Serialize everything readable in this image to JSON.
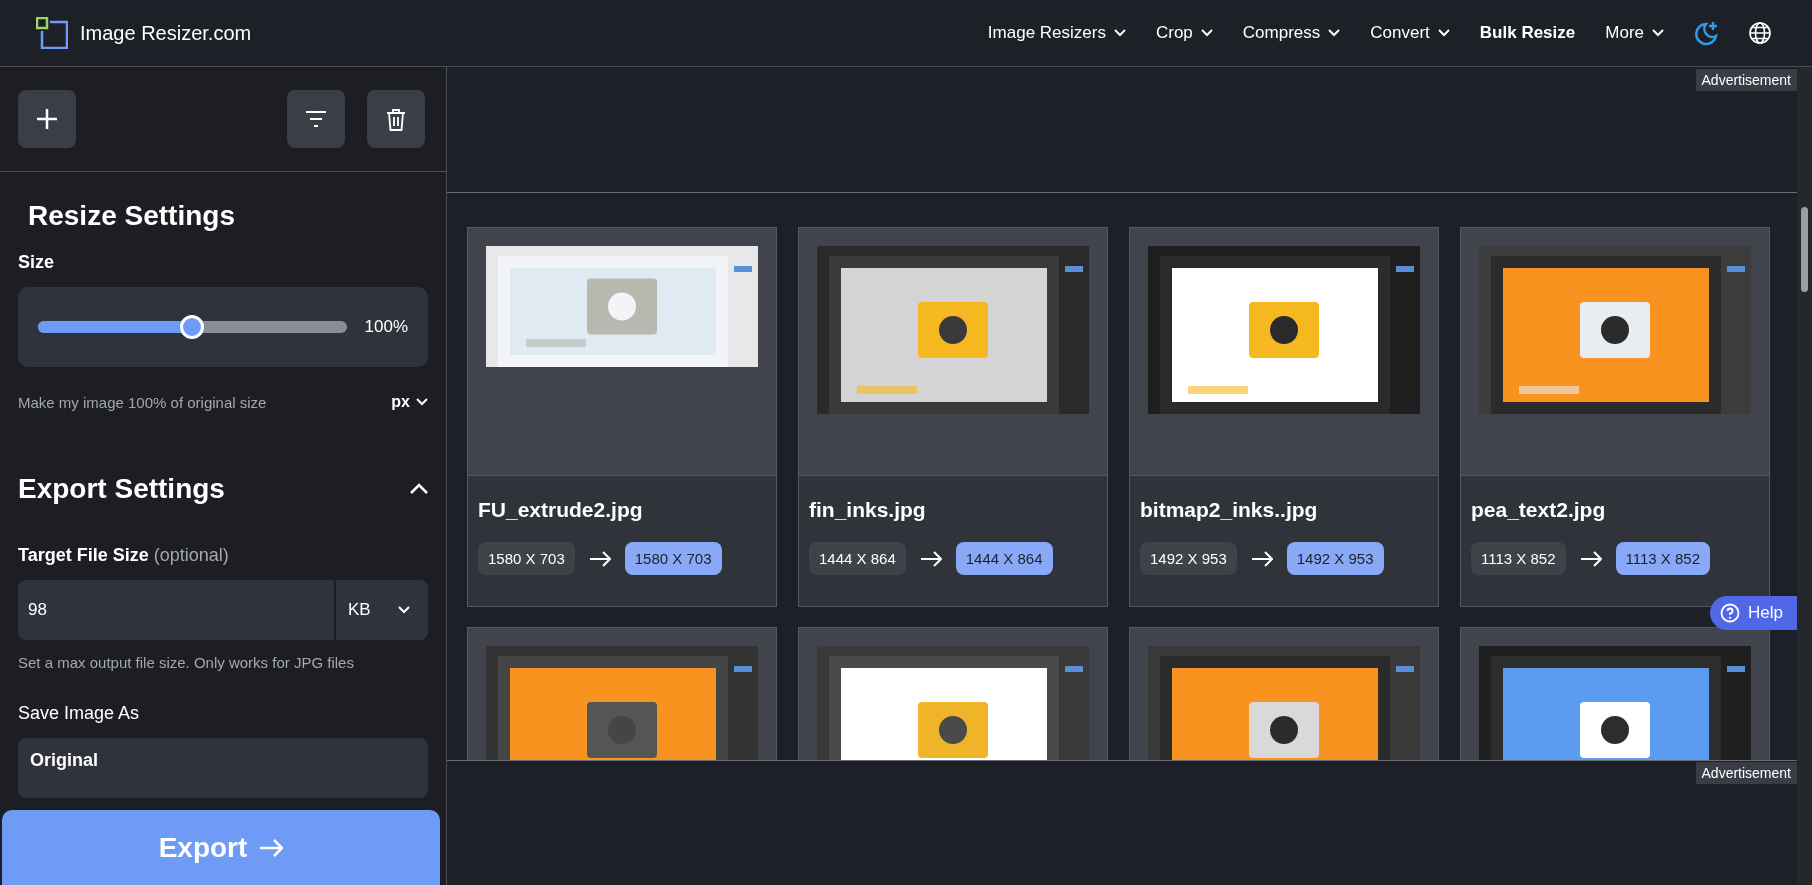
{
  "header": {
    "logo_text": "Image Resizer.com",
    "nav": [
      {
        "label": "Image Resizers",
        "kind": "menu"
      },
      {
        "label": "Crop",
        "kind": "menu"
      },
      {
        "label": "Compress",
        "kind": "menu"
      },
      {
        "label": "Convert",
        "kind": "menu"
      },
      {
        "label": "Bulk Resize",
        "kind": "link"
      },
      {
        "label": "More",
        "kind": "menu"
      }
    ]
  },
  "sidebar": {
    "resize_settings": {
      "title": "Resize Settings",
      "size_label": "Size",
      "slider": {
        "level": 0.5,
        "reading": "100%"
      },
      "hint": "Make my image 100% of original size",
      "unit": "px"
    },
    "export_settings": {
      "title": "Export Settings",
      "expanded": true,
      "target_label": "Target File Size",
      "target_optional": "(optional)",
      "target_value": "98",
      "target_unit": "KB",
      "target_hint": "Set a max output file size. Only works for JPG files",
      "save_as_label": "Save Image As",
      "save_as_value": "Original"
    },
    "export_button": "Export"
  },
  "ads": [
    "Advertisement",
    "Advertisement"
  ],
  "images": [
    {
      "kind": "picture",
      "name": "FU_extrude2.jpg",
      "original_size": "1580 X 703",
      "new_size": "1580 X 703"
    },
    {
      "kind": "picture",
      "name": "fin_inks.jpg",
      "original_size": "1444 X 864",
      "new_size": "1444 X 864"
    },
    {
      "kind": "picture",
      "name": "bitmap2_inks..jpg",
      "original_size": "1492 X 953",
      "new_size": "1492 X 953"
    },
    {
      "kind": "picture",
      "name": "pea_text2.jpg",
      "original_size": "1113 X 852",
      "new_size": "1113 X 852"
    },
    {
      "kind": "picture"
    },
    {
      "kind": "picture"
    },
    {
      "kind": "picture"
    },
    {
      "kind": "picture"
    }
  ],
  "help_button": "Help"
}
